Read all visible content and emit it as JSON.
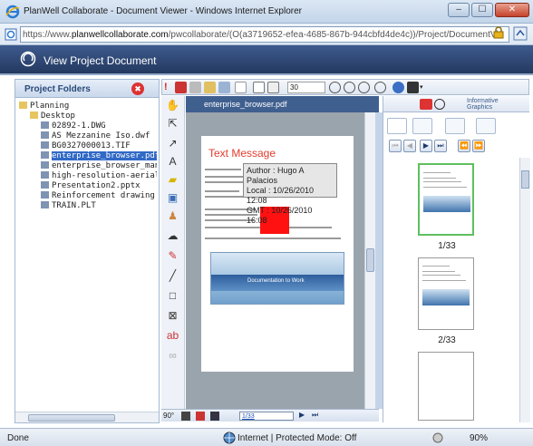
{
  "window": {
    "title": "PlanWell Collaborate - Document Viewer - Windows Internet Explorer",
    "min_label": "‒",
    "max_label": "☐",
    "close_label": "✕"
  },
  "address": {
    "url_prefix": "https://www.",
    "url_domain": "planwellcollaborate.com",
    "url_rest": "/pwcollaborate/(O(a3719652-efea-4685-867b-944cbfd4de4c))/Project/DocumentVi"
  },
  "app": {
    "header_title": "View Project Document"
  },
  "left_panel": {
    "title": "Project Folders",
    "close_label": "✖",
    "tree": [
      {
        "label": "Planning",
        "type": "folder",
        "depth": 0
      },
      {
        "label": "Desktop",
        "type": "folder",
        "depth": 1
      },
      {
        "label": "02892-1.DWG",
        "type": "file",
        "depth": 2
      },
      {
        "label": "AS Mezzanine Iso.dwf",
        "type": "file",
        "depth": 2
      },
      {
        "label": "BG0327000013.TIF",
        "type": "file",
        "depth": 2
      },
      {
        "label": "enterprise_browser.pdf",
        "type": "file",
        "depth": 2,
        "selected": true
      },
      {
        "label": "enterprise_browser_manu",
        "type": "file",
        "depth": 2
      },
      {
        "label": "high-resolution-aerial-phc",
        "type": "file",
        "depth": 2
      },
      {
        "label": "Presentation2.pptx",
        "type": "file",
        "depth": 2
      },
      {
        "label": "Reinforcement drawing 5 -",
        "type": "file",
        "depth": 2
      },
      {
        "label": "TRAIN.PLT",
        "type": "file",
        "depth": 2
      }
    ]
  },
  "toolbar": {
    "zoom_value": "30"
  },
  "document": {
    "filename": "enterprise_browser.pdf",
    "heading": "Text Message",
    "screenshot_caption": "Documentation to Work",
    "markup_tooltip": {
      "author": "Author : Hugo A Palacios",
      "local": "Local : 10/26/2010 12:08",
      "gmt": "GMT : 10/26/2010 16:08"
    }
  },
  "nav": {
    "rotation": "90°",
    "page_field": "1/33"
  },
  "right_panel": {
    "brand": "Informative Graphics",
    "pages": [
      {
        "label": "1/33"
      },
      {
        "label": "2/33"
      }
    ]
  },
  "status": {
    "left": "Done",
    "zone": "Internet | Protected Mode: Off",
    "zoom": "90%"
  },
  "colors": {
    "accent": "#3f5f8f",
    "markup_red": "#ff1111",
    "heading_red": "#e23c2c"
  }
}
